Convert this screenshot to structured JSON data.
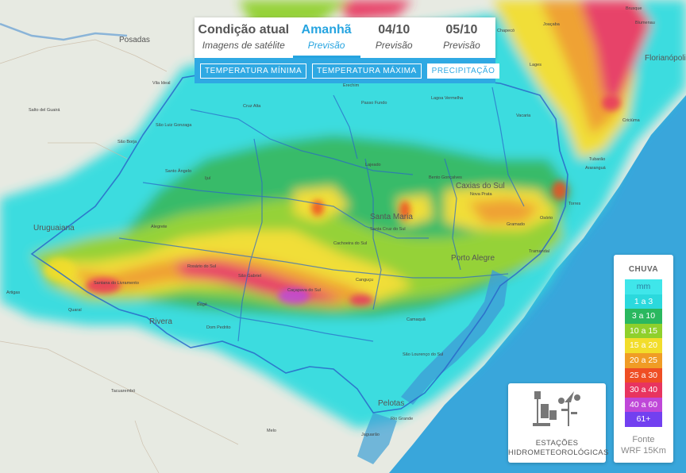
{
  "tabs": [
    {
      "title": "Condição atual",
      "subtitle": "Imagens de satélite",
      "active": false
    },
    {
      "title": "Amanhã",
      "subtitle": "Previsão",
      "active": true
    },
    {
      "title": "04/10",
      "subtitle": "Previsão",
      "active": false
    },
    {
      "title": "05/10",
      "subtitle": "Previsão",
      "active": false
    }
  ],
  "filters": [
    {
      "label": "TEMPERATURA MÍNIMA",
      "selected": false
    },
    {
      "label": "TEMPERATURA MÁXIMA",
      "selected": false
    },
    {
      "label": "PRECIPITAÇÃO",
      "selected": true
    }
  ],
  "legend": {
    "title": "CHUVA",
    "rows": [
      {
        "label": "mm",
        "color": "#3fe6ea"
      },
      {
        "label": "1 a 3",
        "color": "#2bd9dd"
      },
      {
        "label": "3 a 10",
        "color": "#2ab85f"
      },
      {
        "label": "10 a 15",
        "color": "#8fd02c"
      },
      {
        "label": "15 a 20",
        "color": "#f2dd2b"
      },
      {
        "label": "20 a 25",
        "color": "#f09c25"
      },
      {
        "label": "25 a 30",
        "color": "#ef4e24"
      },
      {
        "label": "30 a 40",
        "color": "#e8345f"
      },
      {
        "label": "40 a 60",
        "color": "#bf47d8"
      },
      {
        "label": "61+",
        "color": "#7240f0"
      }
    ],
    "source_label": "Fonte",
    "source_value": "WRF 15Km"
  },
  "stations": {
    "line1": "ESTAÇÕES",
    "line2": "HIDROMETEOROLÓGICAS"
  },
  "big_cities": [
    {
      "name": "Santa Maria"
    },
    {
      "name": "Caxias do Sul"
    },
    {
      "name": "Porto Alegre"
    },
    {
      "name": "Florianópolis"
    },
    {
      "name": "Posadas"
    },
    {
      "name": "Uruguaiana"
    },
    {
      "name": "Pelotas"
    },
    {
      "name": "Rivera"
    }
  ],
  "small_cities": [
    {
      "name": "São Borja"
    },
    {
      "name": "Erechim"
    },
    {
      "name": "Passo Fundo"
    },
    {
      "name": "Lagoa Vermelha"
    },
    {
      "name": "Santo Ângelo"
    },
    {
      "name": "Ijuí"
    },
    {
      "name": "Cruz Alta"
    },
    {
      "name": "Bento Gonçalves"
    },
    {
      "name": "Lajeado"
    },
    {
      "name": "Santa Cruz do Sul"
    },
    {
      "name": "Cachoeira do Sul"
    },
    {
      "name": "Alegrete"
    },
    {
      "name": "Rosário do Sul"
    },
    {
      "name": "São Gabriel"
    },
    {
      "name": "Caçapava do Sul"
    },
    {
      "name": "Bagé"
    },
    {
      "name": "Dom Pedrito"
    },
    {
      "name": "Canguçu"
    },
    {
      "name": "Camaquã"
    },
    {
      "name": "São Lourenço do Sul"
    },
    {
      "name": "Rio Grande"
    },
    {
      "name": "Jaguarão"
    },
    {
      "name": "Tacuarembó"
    },
    {
      "name": "Melo"
    },
    {
      "name": "Artigas"
    },
    {
      "name": "Quaraí"
    },
    {
      "name": "Santana do Livramento"
    },
    {
      "name": "Lages"
    },
    {
      "name": "Criciúma"
    },
    {
      "name": "Tubarão"
    },
    {
      "name": "Araranguá"
    },
    {
      "name": "Torres"
    },
    {
      "name": "Chapecó"
    },
    {
      "name": "Joaçaba"
    },
    {
      "name": "Blumenau"
    },
    {
      "name": "Brusque"
    },
    {
      "name": "Vacaria"
    },
    {
      "name": "Nova Prata"
    },
    {
      "name": "Gramado"
    },
    {
      "name": "Osório"
    },
    {
      "name": "Tramandaí"
    },
    {
      "name": "Vila Ideal"
    },
    {
      "name": "São Luiz Gonzaga"
    },
    {
      "name": "Salto del Guairá"
    }
  ]
}
